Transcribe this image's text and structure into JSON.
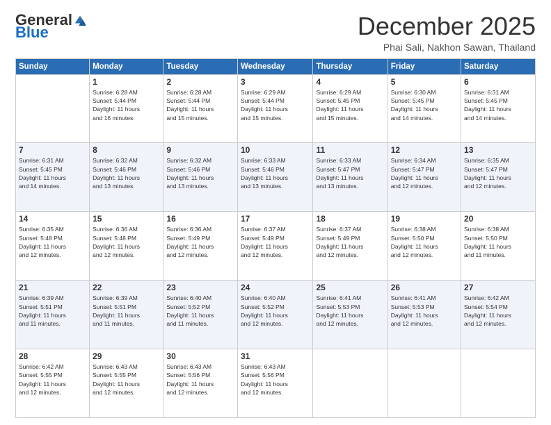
{
  "logo": {
    "general": "General",
    "blue": "Blue"
  },
  "title": "December 2025",
  "subtitle": "Phai Sali, Nakhon Sawan, Thailand",
  "days_of_week": [
    "Sunday",
    "Monday",
    "Tuesday",
    "Wednesday",
    "Thursday",
    "Friday",
    "Saturday"
  ],
  "weeks": [
    [
      {
        "day": "",
        "info": ""
      },
      {
        "day": "1",
        "info": "Sunrise: 6:28 AM\nSunset: 5:44 PM\nDaylight: 11 hours\nand 16 minutes."
      },
      {
        "day": "2",
        "info": "Sunrise: 6:28 AM\nSunset: 5:44 PM\nDaylight: 11 hours\nand 15 minutes."
      },
      {
        "day": "3",
        "info": "Sunrise: 6:29 AM\nSunset: 5:44 PM\nDaylight: 11 hours\nand 15 minutes."
      },
      {
        "day": "4",
        "info": "Sunrise: 6:29 AM\nSunset: 5:45 PM\nDaylight: 11 hours\nand 15 minutes."
      },
      {
        "day": "5",
        "info": "Sunrise: 6:30 AM\nSunset: 5:45 PM\nDaylight: 11 hours\nand 14 minutes."
      },
      {
        "day": "6",
        "info": "Sunrise: 6:31 AM\nSunset: 5:45 PM\nDaylight: 11 hours\nand 14 minutes."
      }
    ],
    [
      {
        "day": "7",
        "info": "Sunrise: 6:31 AM\nSunset: 5:45 PM\nDaylight: 11 hours\nand 14 minutes."
      },
      {
        "day": "8",
        "info": "Sunrise: 6:32 AM\nSunset: 5:46 PM\nDaylight: 11 hours\nand 13 minutes."
      },
      {
        "day": "9",
        "info": "Sunrise: 6:32 AM\nSunset: 5:46 PM\nDaylight: 11 hours\nand 13 minutes."
      },
      {
        "day": "10",
        "info": "Sunrise: 6:33 AM\nSunset: 5:46 PM\nDaylight: 11 hours\nand 13 minutes."
      },
      {
        "day": "11",
        "info": "Sunrise: 6:33 AM\nSunset: 5:47 PM\nDaylight: 11 hours\nand 13 minutes."
      },
      {
        "day": "12",
        "info": "Sunrise: 6:34 AM\nSunset: 5:47 PM\nDaylight: 11 hours\nand 12 minutes."
      },
      {
        "day": "13",
        "info": "Sunrise: 6:35 AM\nSunset: 5:47 PM\nDaylight: 11 hours\nand 12 minutes."
      }
    ],
    [
      {
        "day": "14",
        "info": "Sunrise: 6:35 AM\nSunset: 5:48 PM\nDaylight: 11 hours\nand 12 minutes."
      },
      {
        "day": "15",
        "info": "Sunrise: 6:36 AM\nSunset: 5:48 PM\nDaylight: 11 hours\nand 12 minutes."
      },
      {
        "day": "16",
        "info": "Sunrise: 6:36 AM\nSunset: 5:49 PM\nDaylight: 11 hours\nand 12 minutes."
      },
      {
        "day": "17",
        "info": "Sunrise: 6:37 AM\nSunset: 5:49 PM\nDaylight: 11 hours\nand 12 minutes."
      },
      {
        "day": "18",
        "info": "Sunrise: 6:37 AM\nSunset: 5:49 PM\nDaylight: 11 hours\nand 12 minutes."
      },
      {
        "day": "19",
        "info": "Sunrise: 6:38 AM\nSunset: 5:50 PM\nDaylight: 11 hours\nand 12 minutes."
      },
      {
        "day": "20",
        "info": "Sunrise: 6:38 AM\nSunset: 5:50 PM\nDaylight: 11 hours\nand 11 minutes."
      }
    ],
    [
      {
        "day": "21",
        "info": "Sunrise: 6:39 AM\nSunset: 5:51 PM\nDaylight: 11 hours\nand 11 minutes."
      },
      {
        "day": "22",
        "info": "Sunrise: 6:39 AM\nSunset: 5:51 PM\nDaylight: 11 hours\nand 11 minutes."
      },
      {
        "day": "23",
        "info": "Sunrise: 6:40 AM\nSunset: 5:52 PM\nDaylight: 11 hours\nand 11 minutes."
      },
      {
        "day": "24",
        "info": "Sunrise: 6:40 AM\nSunset: 5:52 PM\nDaylight: 11 hours\nand 12 minutes."
      },
      {
        "day": "25",
        "info": "Sunrise: 6:41 AM\nSunset: 5:53 PM\nDaylight: 11 hours\nand 12 minutes."
      },
      {
        "day": "26",
        "info": "Sunrise: 6:41 AM\nSunset: 5:53 PM\nDaylight: 11 hours\nand 12 minutes."
      },
      {
        "day": "27",
        "info": "Sunrise: 6:42 AM\nSunset: 5:54 PM\nDaylight: 11 hours\nand 12 minutes."
      }
    ],
    [
      {
        "day": "28",
        "info": "Sunrise: 6:42 AM\nSunset: 5:55 PM\nDaylight: 11 hours\nand 12 minutes."
      },
      {
        "day": "29",
        "info": "Sunrise: 6:43 AM\nSunset: 5:55 PM\nDaylight: 11 hours\nand 12 minutes."
      },
      {
        "day": "30",
        "info": "Sunrise: 6:43 AM\nSunset: 5:56 PM\nDaylight: 11 hours\nand 12 minutes."
      },
      {
        "day": "31",
        "info": "Sunrise: 6:43 AM\nSunset: 5:56 PM\nDaylight: 11 hours\nand 12 minutes."
      },
      {
        "day": "",
        "info": ""
      },
      {
        "day": "",
        "info": ""
      },
      {
        "day": "",
        "info": ""
      }
    ]
  ]
}
